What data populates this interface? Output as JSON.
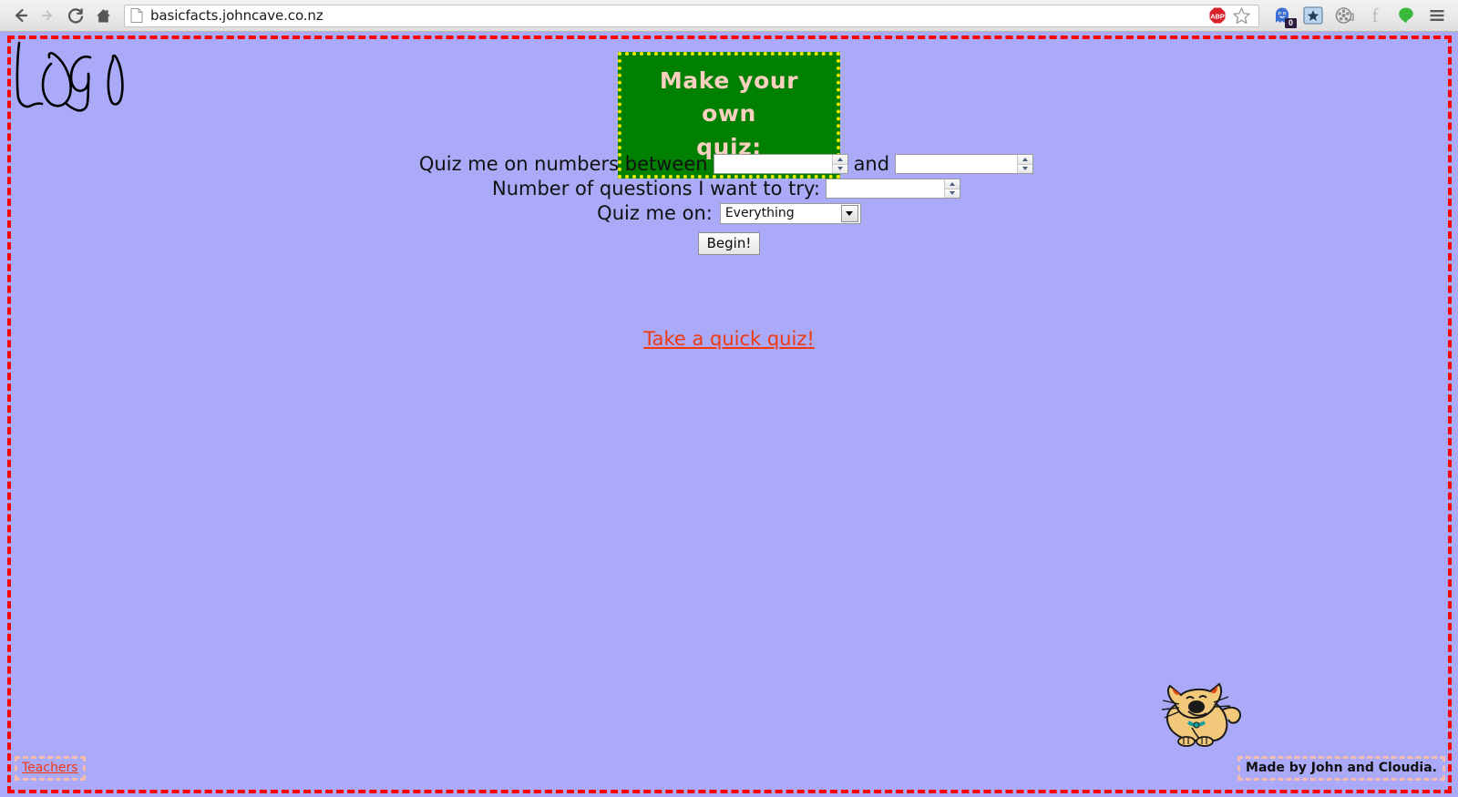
{
  "browser": {
    "url": "basicfacts.johncave.co.nz",
    "nav": {
      "back_label": "Back",
      "forward_label": "Forward",
      "reload_label": "Reload",
      "home_label": "Home"
    },
    "address_icons": {
      "page_icon": "page-icon",
      "adblock_icon": "adblock-plus-icon",
      "adblock_text": "ABP",
      "bookmark_icon": "bookmark-star-icon"
    },
    "extensions": [
      {
        "name": "ghostery-icon",
        "badge": "0"
      },
      {
        "name": "bookmark-star-button-icon",
        "badge": ""
      },
      {
        "name": "film-reel-icon",
        "badge": ""
      },
      {
        "name": "facebook-icon",
        "badge": "",
        "glyph": "f"
      },
      {
        "name": "green-droplet-icon",
        "badge": ""
      },
      {
        "name": "hamburger-menu-icon",
        "badge": ""
      }
    ]
  },
  "page": {
    "background_color": "#aaaaf9",
    "border_color": "#fa0000",
    "logo_alt": "LOGO",
    "banner": {
      "line1": "Make your own",
      "line2": "quiz:",
      "background_color": "#008000",
      "border_color": "#eaea00",
      "text_color": "#fbcfc0"
    },
    "form": {
      "between_label": "Quiz me on numbers between",
      "and_label": "and",
      "min_value": "",
      "min_placeholder": "",
      "max_value": "",
      "max_placeholder": "",
      "questions_label": "Number of questions I want to try:",
      "questions_value": "",
      "questions_placeholder": "",
      "quiz_on_label": "Quiz me on:",
      "quiz_on_selected": "Everything",
      "quiz_on_options": [
        "Everything"
      ],
      "begin_label": "Begin!"
    },
    "quick_quiz_link": "Take a quick quiz!",
    "cat_alt": "cartoon-cat",
    "footer": {
      "teachers_link": "Teachers",
      "made_by": "Made by John and Cloudia.",
      "dashed_box_color": "#f7bcb0"
    }
  }
}
